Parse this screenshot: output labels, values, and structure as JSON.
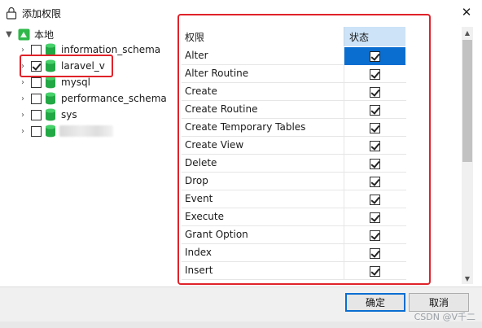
{
  "window": {
    "title": "添加权限",
    "close_glyph": "✕"
  },
  "tree": {
    "root": {
      "label": "本地",
      "expanded": true
    },
    "items": [
      {
        "label": "information_schema",
        "checked": false
      },
      {
        "label": "laravel_v",
        "checked": true,
        "highlighted": true
      },
      {
        "label": "mysql",
        "checked": false
      },
      {
        "label": "performance_schema",
        "checked": false
      },
      {
        "label": "sys",
        "checked": false
      },
      {
        "label": "",
        "checked": false,
        "blurred": true
      }
    ]
  },
  "permissions": {
    "header_name": "权限",
    "header_status": "状态",
    "rows": [
      {
        "name": "Alter",
        "checked": true,
        "selected": true
      },
      {
        "name": "Alter Routine",
        "checked": true
      },
      {
        "name": "Create",
        "checked": true
      },
      {
        "name": "Create Routine",
        "checked": true
      },
      {
        "name": "Create Temporary Tables",
        "checked": true
      },
      {
        "name": "Create View",
        "checked": true
      },
      {
        "name": "Delete",
        "checked": true
      },
      {
        "name": "Drop",
        "checked": true
      },
      {
        "name": "Event",
        "checked": true
      },
      {
        "name": "Execute",
        "checked": true
      },
      {
        "name": "Grant Option",
        "checked": true
      },
      {
        "name": "Index",
        "checked": true
      },
      {
        "name": "Insert",
        "checked": true
      }
    ]
  },
  "footer": {
    "ok_label": "确定",
    "cancel_label": "取消",
    "watermark": "CSDN @V千二"
  },
  "colors": {
    "highlight_box": "#e0222a",
    "selection": "#0a6ed1",
    "header_bg": "#cde3f7"
  }
}
